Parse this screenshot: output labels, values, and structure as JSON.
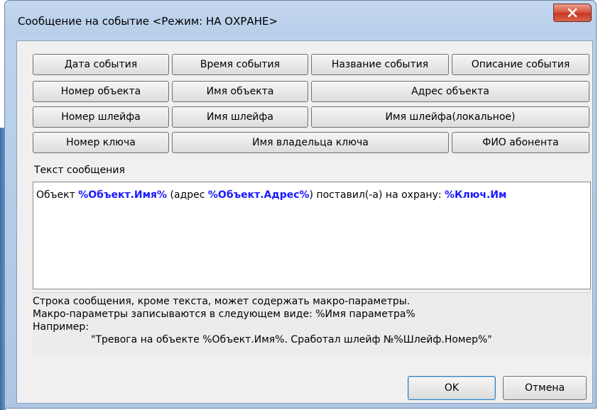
{
  "window": {
    "title": "Сообщение на событие <Режим: НА ОХРАНЕ>",
    "close_glyph": "✕"
  },
  "macro_buttons": {
    "event_date": "Дата события",
    "event_time": "Время события",
    "event_name": "Название события",
    "event_description": "Описание события",
    "object_number": "Номер объекта",
    "object_name": "Имя объекта",
    "object_address": "Адрес объекта",
    "loop_number": "Номер шлейфа",
    "loop_name": "Имя шлейфа",
    "loop_name_local": "Имя шлейфа(локальное)",
    "key_number": "Номер ключа",
    "key_owner_name": "Имя владельца ключа",
    "subscriber_name": "ФИО абонента"
  },
  "message": {
    "caption": "Текст сообщения",
    "part1": "Объект ",
    "macro1": "%Объект.Имя%",
    "part2": " (адрес ",
    "macro2": "%Объект.Адрес%",
    "part3": ") поставил(-а) на охрану: ",
    "macro3": "%Ключ.Им"
  },
  "hint": {
    "line1": "Строка сообщения, кроме текста, может содержать макро-параметры.",
    "line2": "Макро-параметры записываются в следующем виде: %Имя параметра%",
    "line3": "Например:",
    "line4": "\"Тревога на объекте %Объект.Имя%. Сработал шлейф №%Шлейф.Номер%\""
  },
  "footer": {
    "ok_label": "OK",
    "cancel_label": "Отмена"
  },
  "colors": {
    "macro_text": "#1a1aff",
    "client_bg": "#f0f0f0",
    "close_button": "#c73521"
  }
}
